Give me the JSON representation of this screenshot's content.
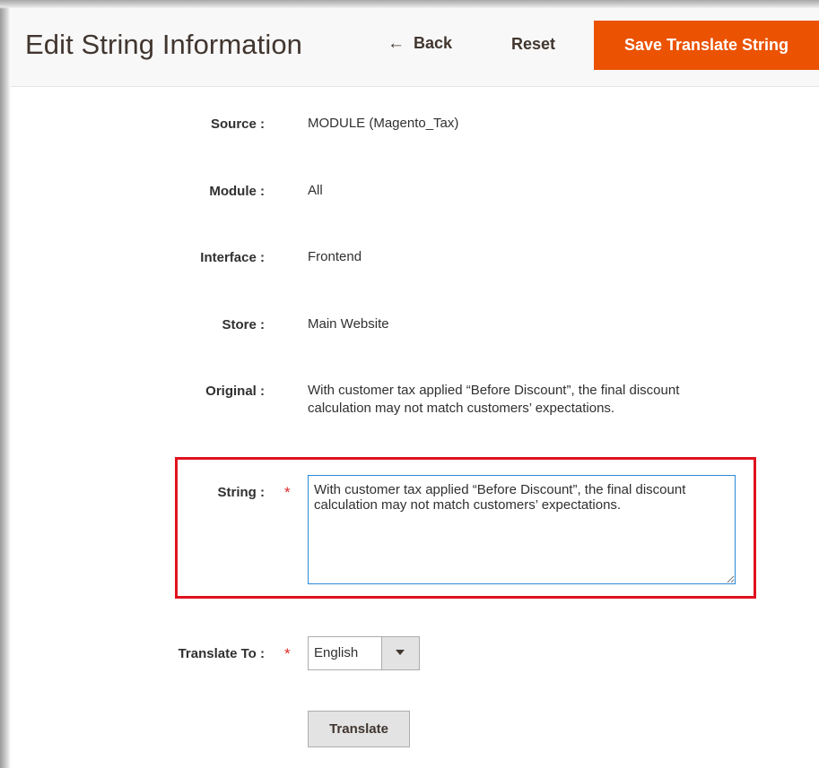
{
  "header": {
    "title": "Edit String Information",
    "back_label": "Back",
    "reset_label": "Reset",
    "save_label": "Save Translate String"
  },
  "fields": {
    "source": {
      "label": "Source :",
      "value": "MODULE (Magento_Tax)"
    },
    "module": {
      "label": "Module :",
      "value": "All"
    },
    "interface": {
      "label": "Interface :",
      "value": "Frontend"
    },
    "store": {
      "label": "Store :",
      "value": "Main Website"
    },
    "original": {
      "label": "Original :",
      "value": "With customer tax applied “Before Discount”, the final discount calculation may not match customers’ expectations."
    },
    "string": {
      "label": "String :",
      "value": "With customer tax applied “Before Discount”, the final discount calculation may not match customers’ expectations."
    },
    "translate_to": {
      "label": "Translate To :",
      "selected": "English"
    }
  },
  "required_marker": "*",
  "translate_button": "Translate",
  "colors": {
    "accent": "#eb5202",
    "highlight_border": "#e0121d",
    "required": "#e02b27",
    "input_focus_border": "#2b8ad8"
  },
  "icons": {
    "back": "arrow-left-icon",
    "select": "caret-down-icon"
  }
}
